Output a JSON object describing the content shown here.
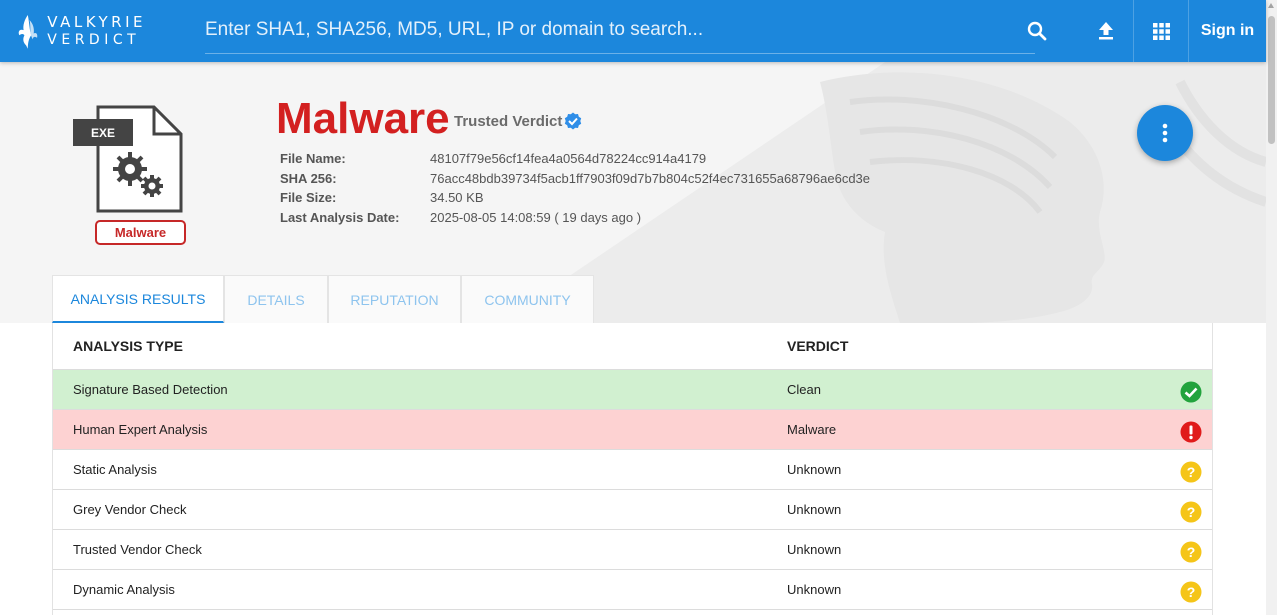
{
  "brand": {
    "line1": "VALKYRIE",
    "line2": "VERDICT"
  },
  "search": {
    "placeholder": "Enter SHA1, SHA256, MD5, URL, IP or domain to search..."
  },
  "header": {
    "signin_label": "Sign in",
    "accent_color": "#1c87dc"
  },
  "file": {
    "type_label": "EXE",
    "badge_label": "Malware",
    "verdict": "Malware",
    "verdict_color": "#d32020",
    "trusted_label": "Trusted Verdict",
    "meta": [
      {
        "key": "File Name:",
        "value": "48107f79e56cf14fea4a0564d78224cc914a4179"
      },
      {
        "key": "SHA 256:",
        "value": "76acc48bdb39734f5acb1ff7903f09d7b7b804c52f4ec731655a68796ae6cd3e"
      },
      {
        "key": "File Size:",
        "value": "34.50 KB"
      },
      {
        "key": "Last Analysis Date:",
        "value": "2025-08-05 14:08:59 ( 19 days ago )"
      }
    ]
  },
  "tabs": [
    {
      "label": "ANALYSIS RESULTS",
      "active": true
    },
    {
      "label": "DETAILS",
      "active": false
    },
    {
      "label": "REPUTATION",
      "active": false
    },
    {
      "label": "COMMUNITY",
      "active": false
    }
  ],
  "table": {
    "headers": [
      "ANALYSIS TYPE",
      "VERDICT"
    ],
    "rows": [
      {
        "type": "Signature Based Detection",
        "verdict": "Clean",
        "status": "check-icon"
      },
      {
        "type": "Human Expert Analysis",
        "verdict": "Malware",
        "status": "alert-icon"
      },
      {
        "type": "Static Analysis",
        "verdict": "Unknown",
        "status": "question-icon"
      },
      {
        "type": "Grey Vendor Check",
        "verdict": "Unknown",
        "status": "question-icon"
      },
      {
        "type": "Trusted Vendor Check",
        "verdict": "Unknown",
        "status": "question-icon"
      },
      {
        "type": "Dynamic Analysis",
        "verdict": "Unknown",
        "status": "question-icon"
      }
    ],
    "colors": {
      "clean_bg": "#d1f0d0",
      "malware_bg": "#fdd2d2",
      "check": "#22a33d",
      "alert": "#e01b1b",
      "question": "#f5c518"
    }
  }
}
